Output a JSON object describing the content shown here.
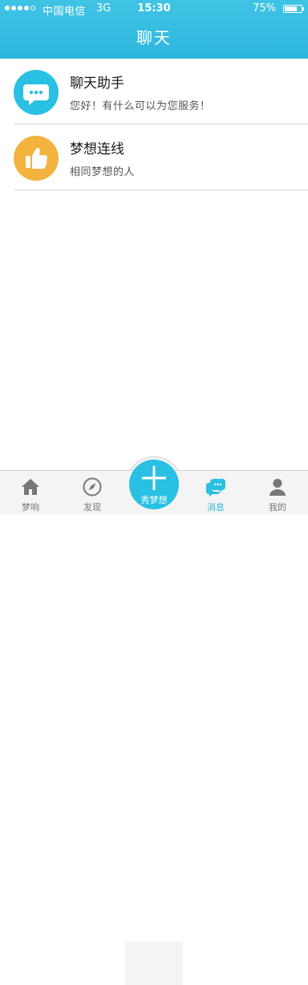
{
  "status_bar": {
    "carrier": "中国电信",
    "network": "3G",
    "time": "15:30",
    "battery": "75%",
    "battery_level": 0.75
  },
  "nav": {
    "title": "聊天"
  },
  "chats": [
    {
      "name": "聊天助手",
      "preview": "您好！有什么可以为您服务！",
      "avatar_icon": "speech-bubble-icon",
      "avatar_color": "#29c0e3"
    },
    {
      "name": "梦想连线",
      "preview": "相同梦想的人",
      "avatar_icon": "thumbs-up-icon",
      "avatar_color": "#f2b33f"
    }
  ],
  "tabs": [
    {
      "label": "梦响",
      "icon": "home-icon",
      "active": false
    },
    {
      "label": "发现",
      "icon": "compass-icon",
      "active": false
    },
    {
      "label": "秀梦想",
      "icon": "plus-icon",
      "active": false
    },
    {
      "label": "消息",
      "icon": "chat-bubbles-icon",
      "active": true
    },
    {
      "label": "我的",
      "icon": "user-icon",
      "active": false
    }
  ],
  "colors": {
    "accent": "#2fb6dd",
    "header": "#3fc4e5",
    "tab_inactive": "#777777"
  }
}
